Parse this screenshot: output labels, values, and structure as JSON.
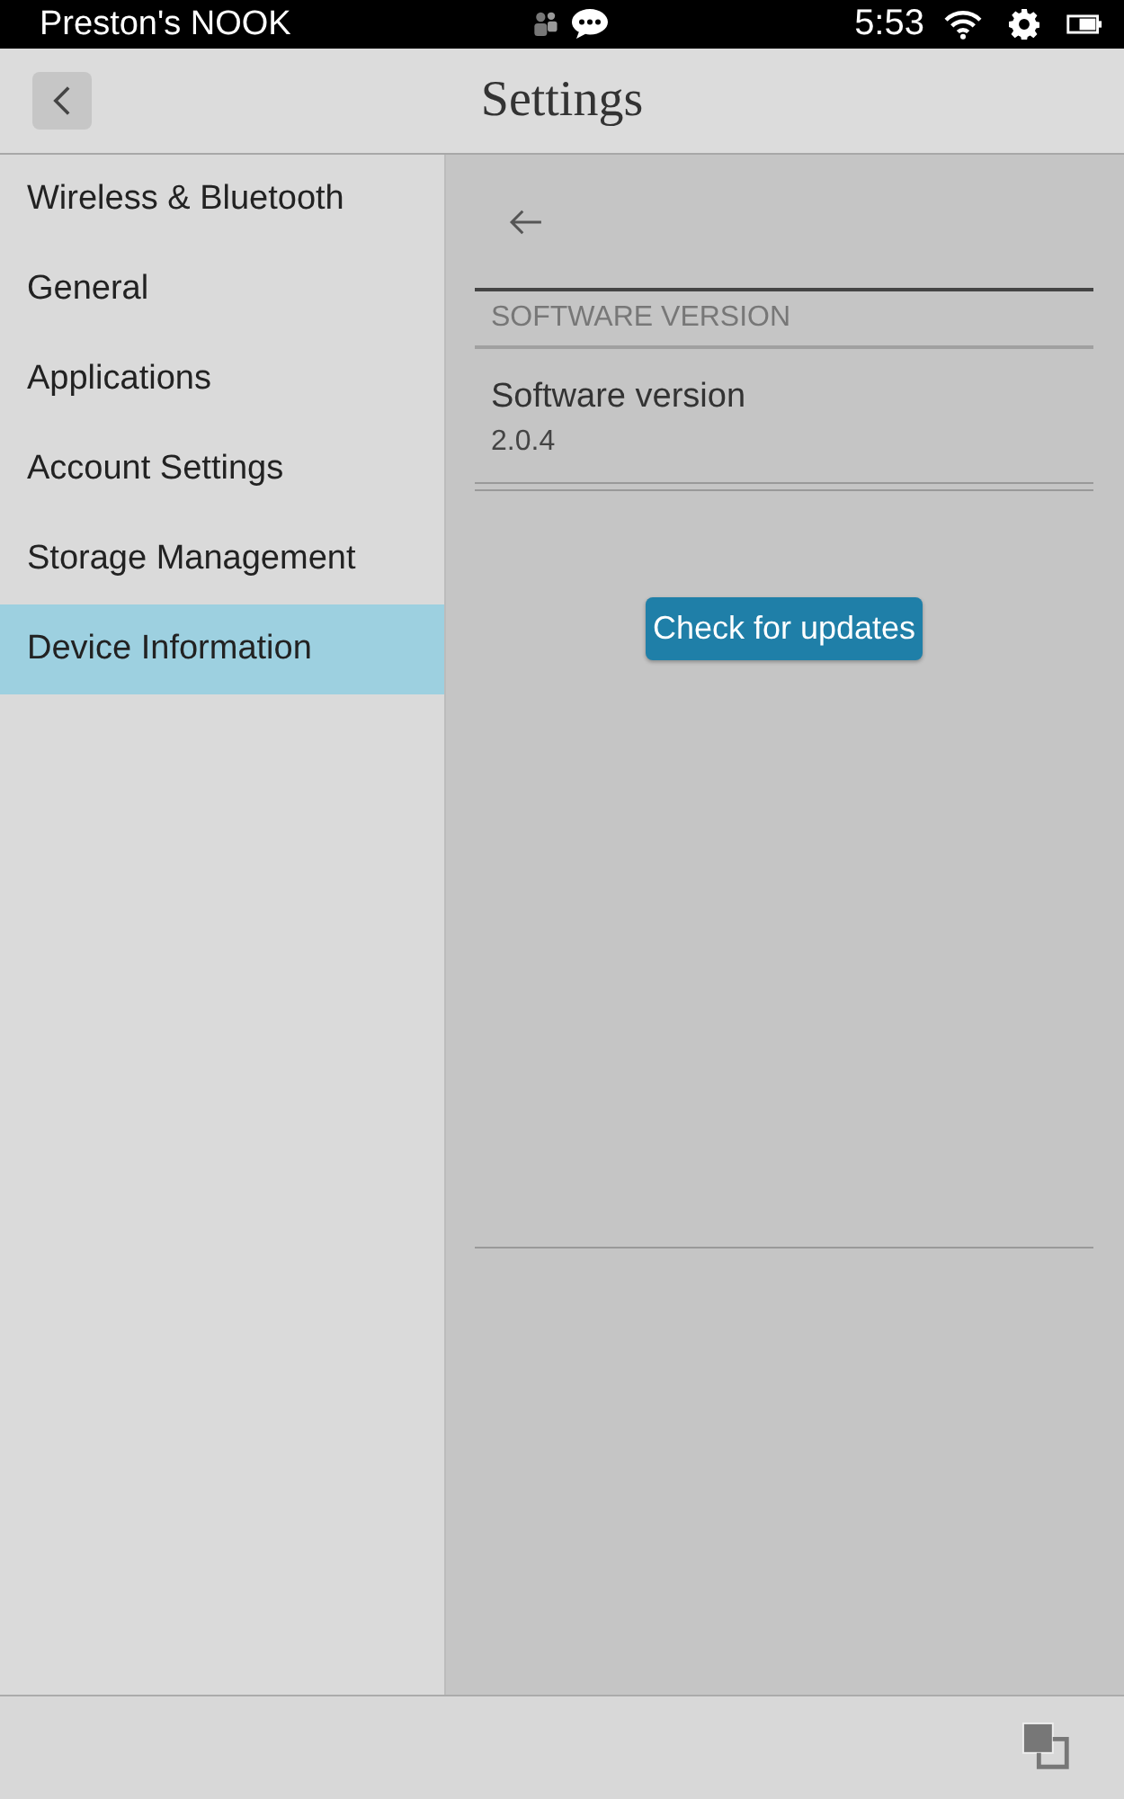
{
  "status_bar": {
    "device_name": "Preston's NOOK",
    "time": "5:53"
  },
  "header": {
    "title": "Settings"
  },
  "sidebar": {
    "items": [
      {
        "label": "Wireless & Bluetooth",
        "selected": false
      },
      {
        "label": "General",
        "selected": false
      },
      {
        "label": "Applications",
        "selected": false
      },
      {
        "label": "Account Settings",
        "selected": false
      },
      {
        "label": "Storage Management",
        "selected": false
      },
      {
        "label": "Device Information",
        "selected": true
      }
    ]
  },
  "detail": {
    "section_header": "SOFTWARE VERSION",
    "rows": [
      {
        "title": "Software version",
        "value": "2.0.4"
      }
    ],
    "button": "Check for updates"
  }
}
